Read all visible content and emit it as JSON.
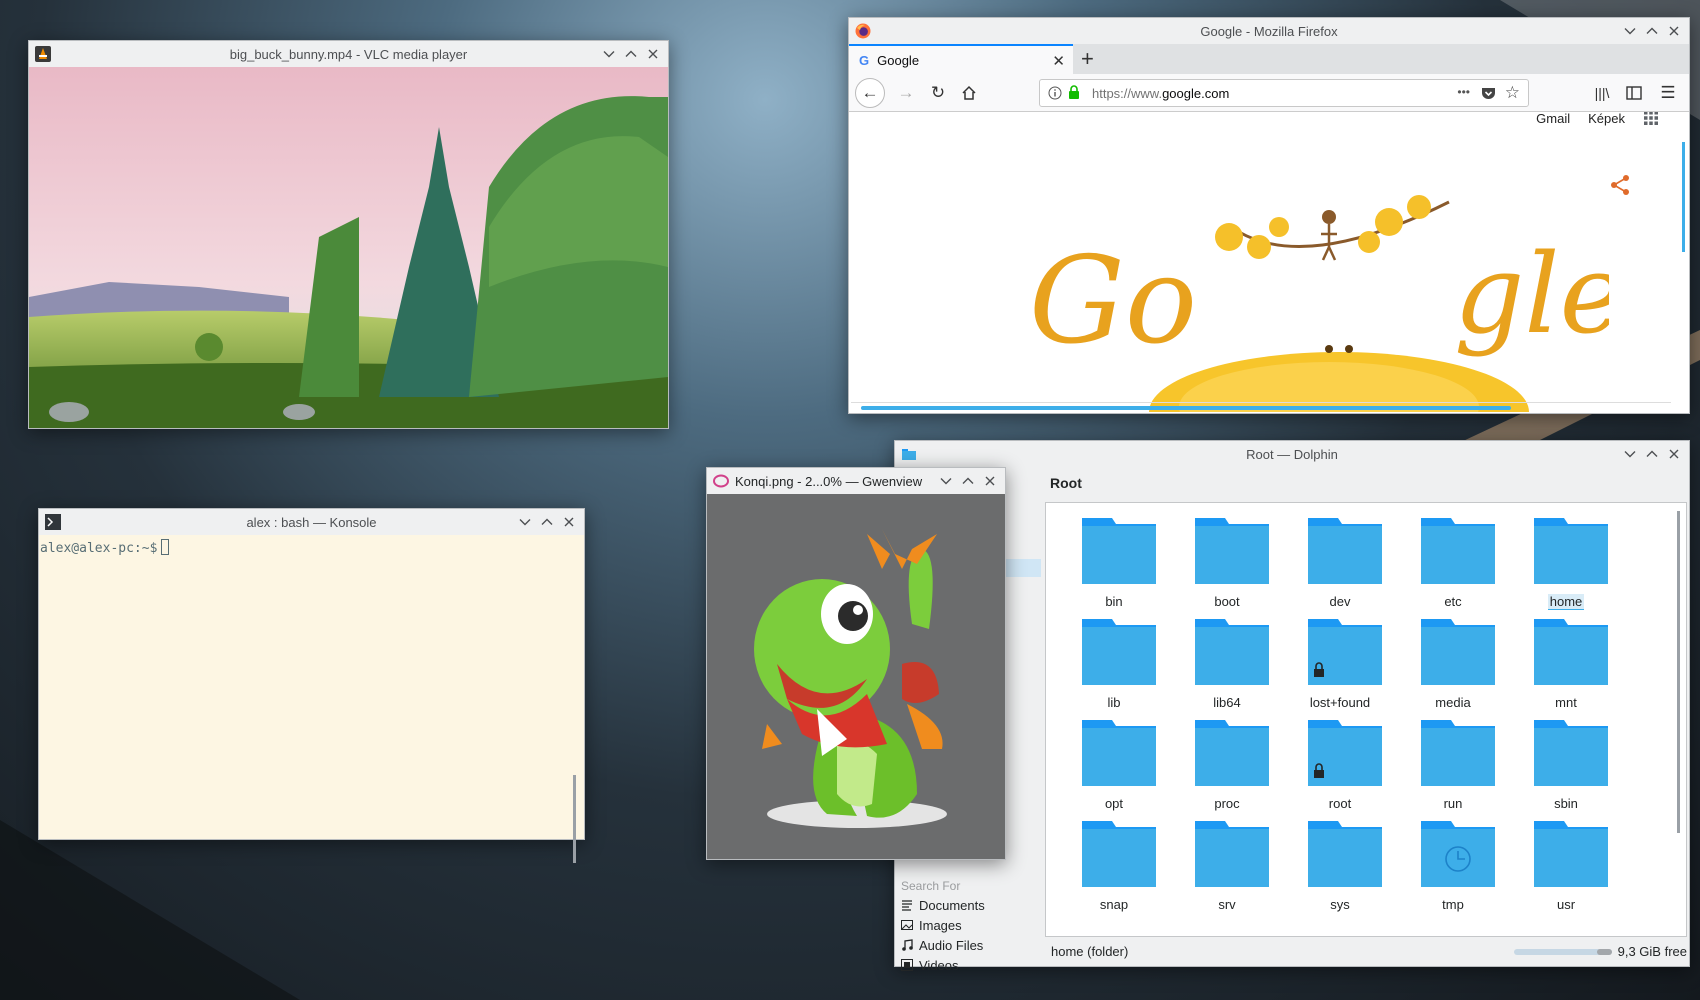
{
  "vlc": {
    "title": "big_buck_bunny.mp4 - VLC media player"
  },
  "firefox": {
    "title": "Google - Mozilla Firefox",
    "tab_label": "Google",
    "new_tab": "+",
    "url_scheme": "https://www.",
    "url_host": "google.com",
    "url_dots": "•••",
    "link_gmail": "Gmail",
    "link_images": "Képek"
  },
  "konsole": {
    "title": "alex : bash — Konsole",
    "prompt": "alex@alex-pc:~$"
  },
  "gwenview": {
    "title": "Konqi.png - 2...0% — Gwenview"
  },
  "dolphin": {
    "title": "Root — Dolphin",
    "breadcrumb": "Root",
    "places_header": "Search For",
    "places": [
      {
        "label": "Documents",
        "icon": "documents-icon"
      },
      {
        "label": "Images",
        "icon": "images-icon"
      },
      {
        "label": "Audio Files",
        "icon": "audio-icon"
      },
      {
        "label": "Videos",
        "icon": "videos-icon"
      }
    ],
    "folders": [
      {
        "name": "bin"
      },
      {
        "name": "boot"
      },
      {
        "name": "dev"
      },
      {
        "name": "etc"
      },
      {
        "name": "home",
        "selected": true
      },
      {
        "name": "lib"
      },
      {
        "name": "lib64"
      },
      {
        "name": "lost+found",
        "locked": true
      },
      {
        "name": "media"
      },
      {
        "name": "mnt"
      },
      {
        "name": "opt"
      },
      {
        "name": "proc"
      },
      {
        "name": "root",
        "locked": true
      },
      {
        "name": "run"
      },
      {
        "name": "sbin"
      },
      {
        "name": "snap"
      },
      {
        "name": "srv"
      },
      {
        "name": "sys"
      },
      {
        "name": "tmp",
        "clock": true
      },
      {
        "name": "usr"
      }
    ],
    "status_left": "home (folder)",
    "free_space": "9,3 GiB free",
    "used_fraction": 0.15
  },
  "colors": {
    "folder_top": "#1d99f3",
    "folder_body": "#3daee9",
    "accent": "#3daee9",
    "terminal_bg": "#fdf6e3"
  }
}
